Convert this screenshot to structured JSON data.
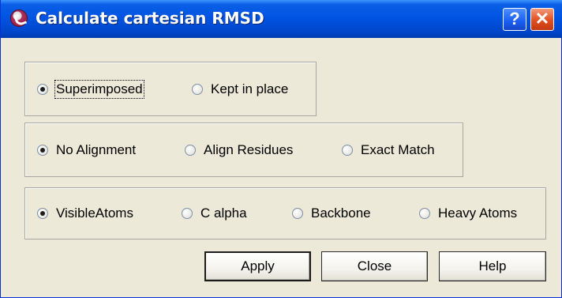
{
  "window": {
    "title": "Calculate cartesian RMSD",
    "help_button": "?",
    "close_button": "✕"
  },
  "groups": [
    {
      "options": [
        {
          "label": "Superimposed",
          "checked": true,
          "focused": true
        },
        {
          "label": "Kept in place",
          "checked": false
        }
      ]
    },
    {
      "options": [
        {
          "label": "No Alignment",
          "checked": true
        },
        {
          "label": "Align Residues",
          "checked": false
        },
        {
          "label": "Exact Match",
          "checked": false
        }
      ]
    },
    {
      "options": [
        {
          "label": "VisibleAtoms",
          "checked": true
        },
        {
          "label": "C alpha",
          "checked": false
        },
        {
          "label": "Backbone",
          "checked": false
        },
        {
          "label": "Heavy Atoms",
          "checked": false
        }
      ]
    }
  ],
  "buttons": {
    "apply": "Apply",
    "close": "Close",
    "help": "Help"
  }
}
